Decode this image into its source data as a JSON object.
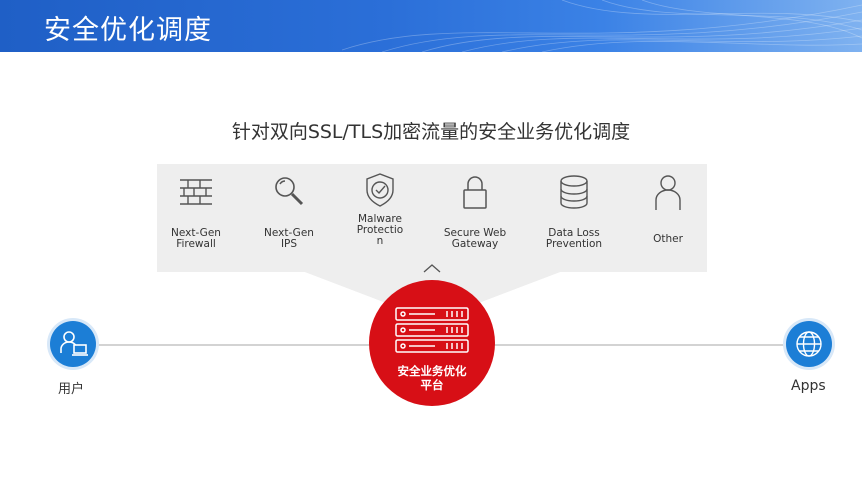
{
  "header": {
    "title": "安全优化调度"
  },
  "subtitle": "针对双向SSL/TLS加密流量的安全业务优化调度",
  "services": [
    {
      "label": "Next-Gen\nFirewall",
      "icon": "firewall-icon"
    },
    {
      "label": "Next-Gen\nIPS",
      "icon": "magnifier-icon"
    },
    {
      "label": "Malware\nProtectio\nn",
      "icon": "shield-check-icon"
    },
    {
      "label": "Secure Web\nGateway",
      "icon": "lock-icon"
    },
    {
      "label": "Data Loss\nPrevention",
      "icon": "database-icon"
    },
    {
      "label": "Other",
      "icon": "person-icon"
    }
  ],
  "nodes": {
    "user": {
      "label": "用户",
      "icon": "user-computer-icon"
    },
    "platform": {
      "label": "安全业务优化\n平台",
      "icon": "server-rack-icon"
    },
    "apps": {
      "label": "Apps",
      "icon": "globe-icon"
    }
  },
  "colors": {
    "banner": "#2b6fd8",
    "platform": "#d70f16",
    "node": "#1c7ed6",
    "panel": "#eeeeee"
  }
}
